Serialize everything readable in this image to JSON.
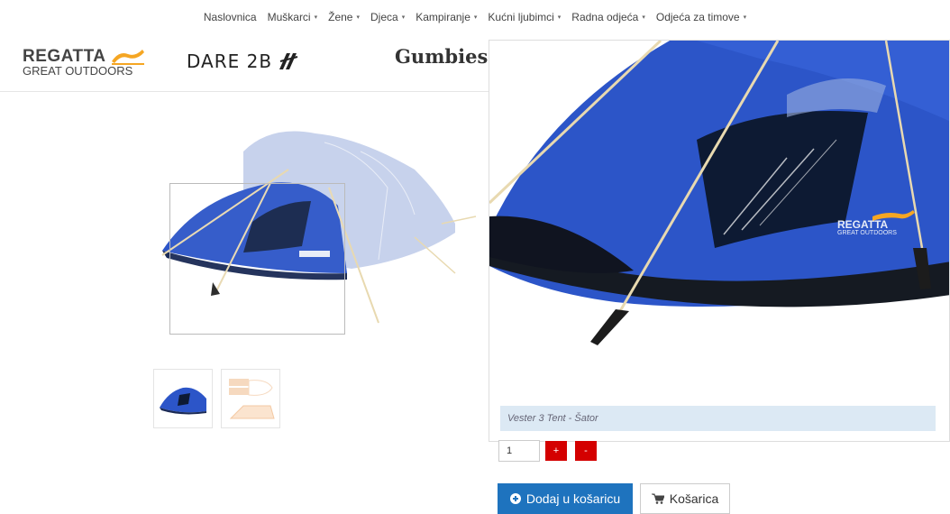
{
  "nav": {
    "items": [
      {
        "label": "Naslovnica",
        "has_caret": false
      },
      {
        "label": "Muškarci",
        "has_caret": true
      },
      {
        "label": "Žene",
        "has_caret": true
      },
      {
        "label": "Djeca",
        "has_caret": true
      },
      {
        "label": "Kampiranje",
        "has_caret": true
      },
      {
        "label": "Kućni ljubimci",
        "has_caret": true
      },
      {
        "label": "Radna odjeća",
        "has_caret": true
      },
      {
        "label": "Odjeća za timove",
        "has_caret": true
      }
    ],
    "caret_glyph": "▾"
  },
  "brands": {
    "regatta": {
      "line1": "REGATTA",
      "line2": "GREAT OUTDOORS",
      "accent": "#f5a623"
    },
    "dare2b": {
      "text": "DARE 2B"
    },
    "gumbies": {
      "text": "Gumbies"
    }
  },
  "product": {
    "zoom_caption": "Vester 3 Tent - Šator",
    "zoom_logo_line1": "REGATTA",
    "zoom_logo_line2": "GREAT OUTDOORS",
    "tent_color": "#2c55c8"
  },
  "purchase": {
    "quantity": "1",
    "plus_label": "+",
    "minus_label": "-",
    "add_to_cart_label": "Dodaj u košaricu",
    "add_icon": "plus-icon",
    "cart_label": "Košarica",
    "cart_icon": "cart-icon",
    "accent": "#1e73be",
    "danger": "#d40000"
  }
}
